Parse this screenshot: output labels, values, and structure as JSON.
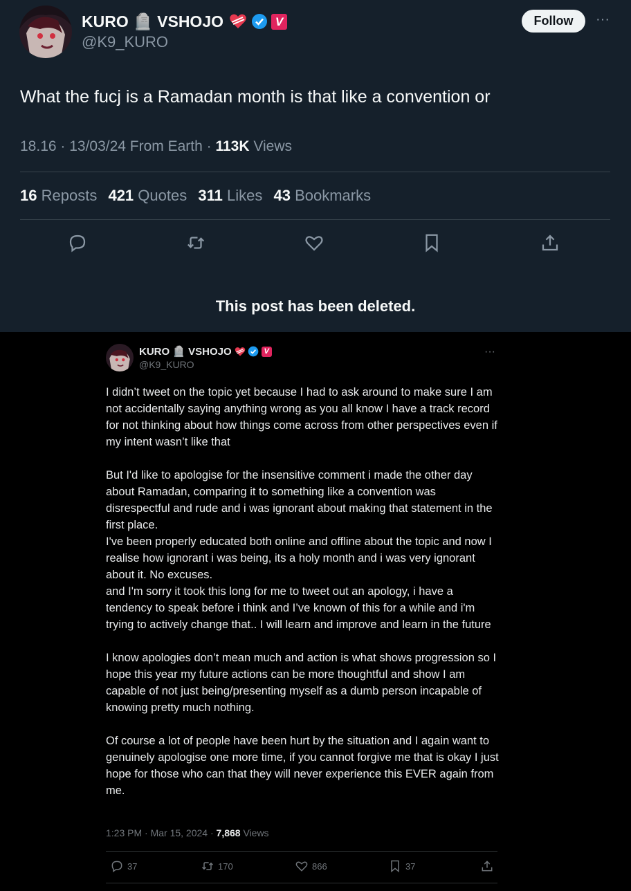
{
  "top_post": {
    "display_name": "KURO 🪦 VSHOJO",
    "handle": "@K9_KURO",
    "follow_label": "Follow",
    "text": "What the fucj is a Ramadan month is that like a convention or",
    "time": "18.16 · 13/03/24 From Earth · ",
    "views_count": "113K",
    "views_label": " Views",
    "stats": {
      "reposts_count": "16",
      "reposts_label": "Reposts",
      "quotes_count": "421",
      "quotes_label": "Quotes",
      "likes_count": "311",
      "likes_label": "Likes",
      "bookmarks_count": "43",
      "bookmarks_label": "Bookmarks"
    },
    "deleted_notice": "This post has been deleted."
  },
  "bottom_post": {
    "display_name": "KURO 🪦 VSHOJO",
    "handle": "@K9_KURO",
    "paragraphs": [
      "I didn’t tweet on the topic yet because I had to ask around to make sure I am not accidentally saying anything wrong as you all know I have a track record for not thinking about how things come across from other perspectives even if my intent wasn’t like that",
      "But I'd like to apologise for the insensitive comment i made the other day about Ramadan, comparing it to something like a convention was disrespectful and rude and i was ignorant about making that statement in the first place.\nI've been properly educated both online and offline about the topic and now I realise how ignorant i was being, its a holy month and i was very ignorant about it. No excuses.\nand I'm sorry it took this long for me to tweet out an apology, i have a tendency to speak before i think and I’ve known of this for a while and i'm trying to actively change that.. I will learn and improve and learn in the future",
      "I know apologies don’t mean much and action is what shows progression so I hope this year my future actions can be more thoughtful and show I am capable of not just being/presenting myself as a dumb person incapable of knowing pretty much nothing.",
      "Of course a lot of people have been hurt by the situation and I again want to genuinely apologise one more time, if you cannot forgive me that is okay I just hope for those who can that they will never experience this EVER again from me."
    ],
    "time": "1:23 PM · Mar 15, 2024 · ",
    "views_count": "7,868",
    "views_label": " Views",
    "actions": {
      "replies": "37",
      "reposts": "170",
      "likes": "866",
      "bookmarks": "37"
    }
  },
  "badges": {
    "verified_color": "#1d9bf0",
    "vshojo_color": "#e0245e",
    "vshojo_letter": "V"
  },
  "icons": [
    "heart-badge-icon",
    "verified-icon",
    "vshojo-badge-icon",
    "reply-icon",
    "repost-icon",
    "like-icon",
    "bookmark-icon",
    "share-icon",
    "more-icon"
  ]
}
